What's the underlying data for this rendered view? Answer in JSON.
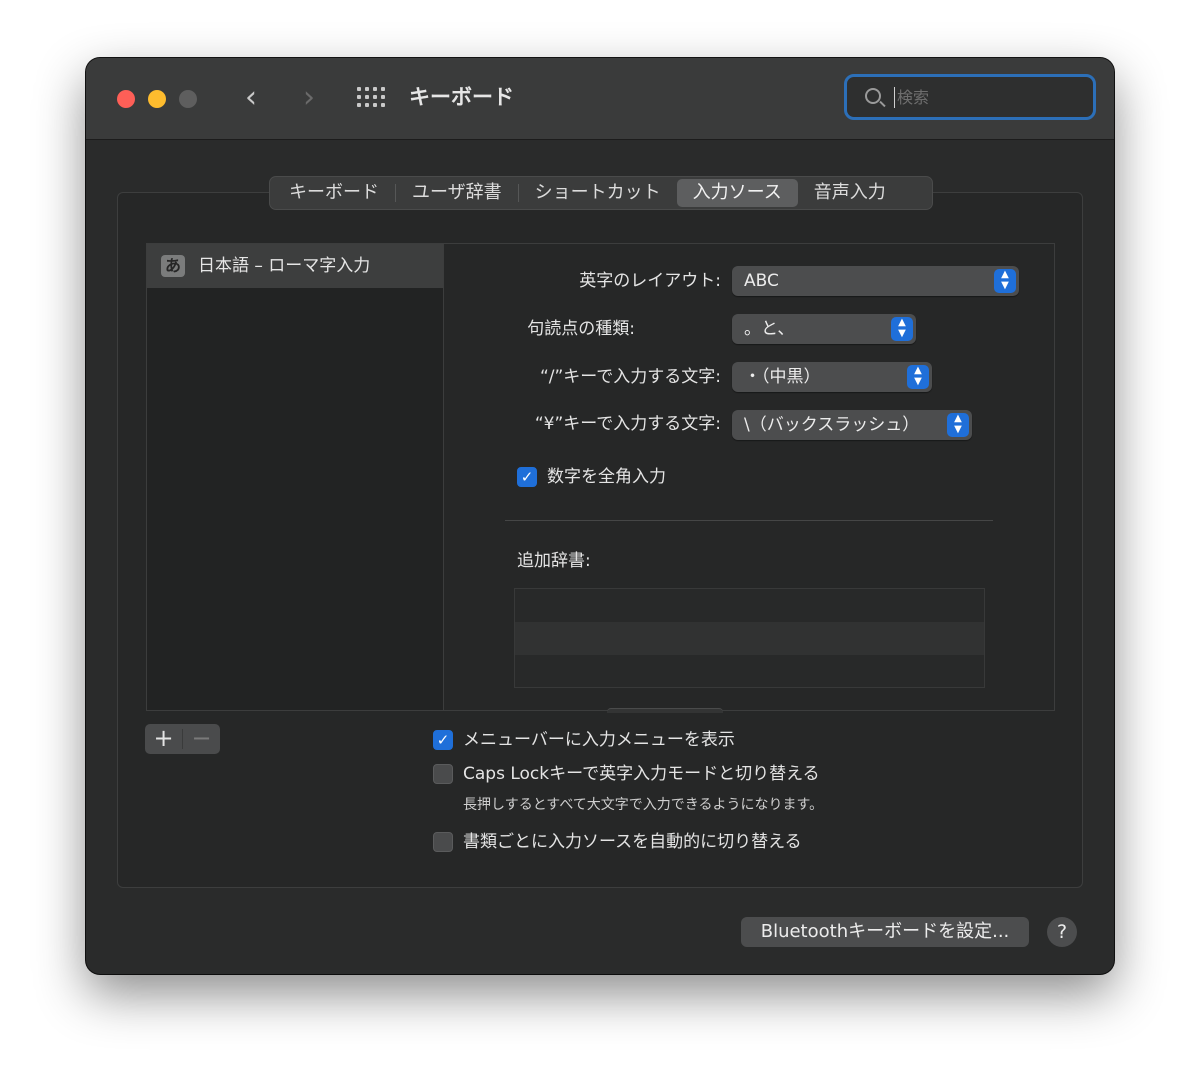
{
  "window": {
    "title": "キーボード",
    "search_placeholder": "検索"
  },
  "tabs": [
    {
      "label": "キーボード",
      "active": false
    },
    {
      "label": "ユーザ辞書",
      "active": false
    },
    {
      "label": "ショートカット",
      "active": false
    },
    {
      "label": "入力ソース",
      "active": true
    },
    {
      "label": "音声入力",
      "active": false
    }
  ],
  "sources": [
    {
      "badge": "あ",
      "label": "日本語 – ローマ字入力"
    }
  ],
  "settings": {
    "layout_label": "英字のレイアウト:",
    "layout_value": "ABC",
    "punct_label": "句読点の種類:",
    "punct_value": "。と、",
    "slash_label": "“/”キーで入力する文字:",
    "slash_value": "・（中黒）",
    "yen_label": "“¥”キーで入力する文字:",
    "yen_value": "\\（バックスラッシュ）",
    "fullwidth_label": "数字を全角入力",
    "fullwidth_checked": true,
    "dict_label": "追加辞書:"
  },
  "bottom": {
    "add_symbol": "+",
    "remove_symbol": "−",
    "menu_label": "メニューバーに入力メニューを表示",
    "menu_checked": true,
    "caps_label": "Caps Lockキーで英字入力モードと切り替える",
    "caps_checked": false,
    "caps_note": "長押しするとすべて大文字で入力できるようになります。",
    "auto_label": "書類ごとに入力ソースを自動的に切り替える",
    "auto_checked": false,
    "bluetooth_label": "Bluetoothキーボードを設定...",
    "help_label": "?"
  },
  "colors": {
    "accent": "#1f6fd9",
    "close": "#fe5f57",
    "minimize": "#febc2e",
    "search_focus": "#2c6fb8"
  }
}
